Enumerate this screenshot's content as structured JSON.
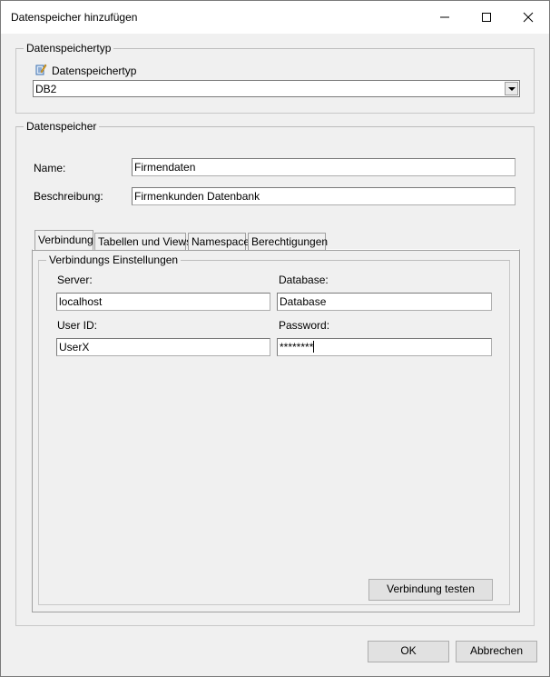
{
  "window": {
    "title": "Datenspeicher hinzufügen"
  },
  "type_group": {
    "legend": "Datenspeichertyp",
    "field_label": "Datenspeichertyp",
    "combo_value": "DB2"
  },
  "store_group": {
    "legend": "Datenspeicher",
    "name_label": "Name:",
    "name_value": "Firmendaten",
    "desc_label": "Beschreibung:",
    "desc_value": "Firmenkunden Datenbank"
  },
  "tabs": [
    {
      "label": "Verbindung"
    },
    {
      "label": "Tabellen und Views"
    },
    {
      "label": "Namespace"
    },
    {
      "label": "Berechtigungen"
    }
  ],
  "connection": {
    "legend": "Verbindungs Einstellungen",
    "server_label": "Server:",
    "server_value": "localhost",
    "database_label": "Database:",
    "database_value": "Database",
    "userid_label": "User ID:",
    "userid_value": "UserX",
    "password_label": "Password:",
    "password_value": "********",
    "test_button": "Verbindung testen"
  },
  "footer": {
    "ok_label": "OK",
    "cancel_label": "Abbrechen"
  },
  "icons": {
    "minimize": "minimize-icon",
    "maximize": "maximize-icon",
    "close": "close-icon",
    "type_icon": "database-type-icon",
    "combo_arrow": "chevron-down-icon"
  }
}
